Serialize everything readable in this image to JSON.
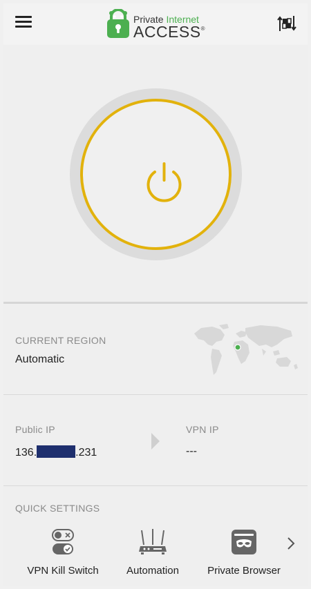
{
  "header": {
    "logo_top_plain": "Private ",
    "logo_top_accent": "Internet",
    "logo_main": "ACCESS",
    "logo_reg": "®"
  },
  "region": {
    "label": "CURRENT REGION",
    "value": "Automatic"
  },
  "ip": {
    "public_label": "Public IP",
    "public_prefix": "136.",
    "public_suffix": ".231",
    "vpn_label": "VPN IP",
    "vpn_value": "---"
  },
  "quick_settings": {
    "label": "QUICK SETTINGS",
    "items": [
      {
        "label": "VPN Kill Switch",
        "icon": "kill-switch-icon"
      },
      {
        "label": "Automation",
        "icon": "router-icon"
      },
      {
        "label": "Private Browser",
        "icon": "private-browser-icon"
      }
    ]
  },
  "colors": {
    "power_ring": "#e2b20c",
    "brand_green": "#4caf50",
    "redaction": "#1e2f6e"
  }
}
